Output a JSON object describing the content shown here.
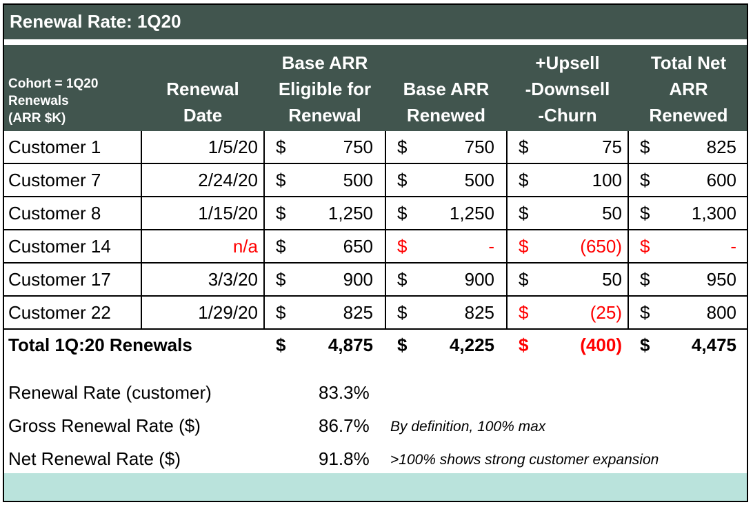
{
  "title": "Renewal Rate: 1Q20",
  "headers": {
    "cohort": "Cohort = 1Q20\nRenewals\n(ARR $K)",
    "renewal_date": "Renewal\nDate",
    "base_eligible": "Base ARR\nEligible for\nRenewal",
    "base_renewed": "Base ARR\nRenewed",
    "upsell": "+Upsell\n-Downsell\n-Churn",
    "total_net": "Total Net\nARR\nRenewed"
  },
  "currency_symbol": "$",
  "rows": [
    {
      "customer": "Customer 1",
      "date": "1/5/20",
      "date_red": false,
      "eligible": "750",
      "renewed": "750",
      "renewed_red": false,
      "upsell": "75",
      "upsell_red": false,
      "total": "825",
      "total_red": false
    },
    {
      "customer": "Customer 7",
      "date": "2/24/20",
      "date_red": false,
      "eligible": "500",
      "renewed": "500",
      "renewed_red": false,
      "upsell": "100",
      "upsell_red": false,
      "total": "600",
      "total_red": false
    },
    {
      "customer": "Customer 8",
      "date": "1/15/20",
      "date_red": false,
      "eligible": "1,250",
      "renewed": "1,250",
      "renewed_red": false,
      "upsell": "50",
      "upsell_red": false,
      "total": "1,300",
      "total_red": false
    },
    {
      "customer": "Customer 14",
      "date": "n/a",
      "date_red": true,
      "eligible": "650",
      "renewed": "-",
      "renewed_red": true,
      "upsell": "(650)",
      "upsell_red": true,
      "total": "-",
      "total_red": true
    },
    {
      "customer": "Customer 17",
      "date": "3/3/20",
      "date_red": false,
      "eligible": "900",
      "renewed": "900",
      "renewed_red": false,
      "upsell": "50",
      "upsell_red": false,
      "total": "950",
      "total_red": false
    },
    {
      "customer": "Customer 22",
      "date": "1/29/20",
      "date_red": false,
      "eligible": "825",
      "renewed": "825",
      "renewed_red": false,
      "upsell": "(25)",
      "upsell_red": true,
      "total": "800",
      "total_red": false
    }
  ],
  "total": {
    "label": "Total 1Q:20 Renewals",
    "eligible": "4,875",
    "renewed": "4,225",
    "upsell": "(400)",
    "upsell_red": true,
    "total": "4,475"
  },
  "metrics": [
    {
      "label": "Renewal Rate (customer)",
      "value": "83.3%",
      "note": ""
    },
    {
      "label": "Gross Renewal Rate ($)",
      "value": "86.7%",
      "note": "By definition, 100% max"
    },
    {
      "label": "Net Renewal Rate ($)",
      "value": "91.8%",
      "note": ">100% shows strong customer expansion"
    }
  ],
  "colors": {
    "header_bg": "#41554e",
    "negative": "#ff0000",
    "footer_band": "#bae3dc"
  }
}
